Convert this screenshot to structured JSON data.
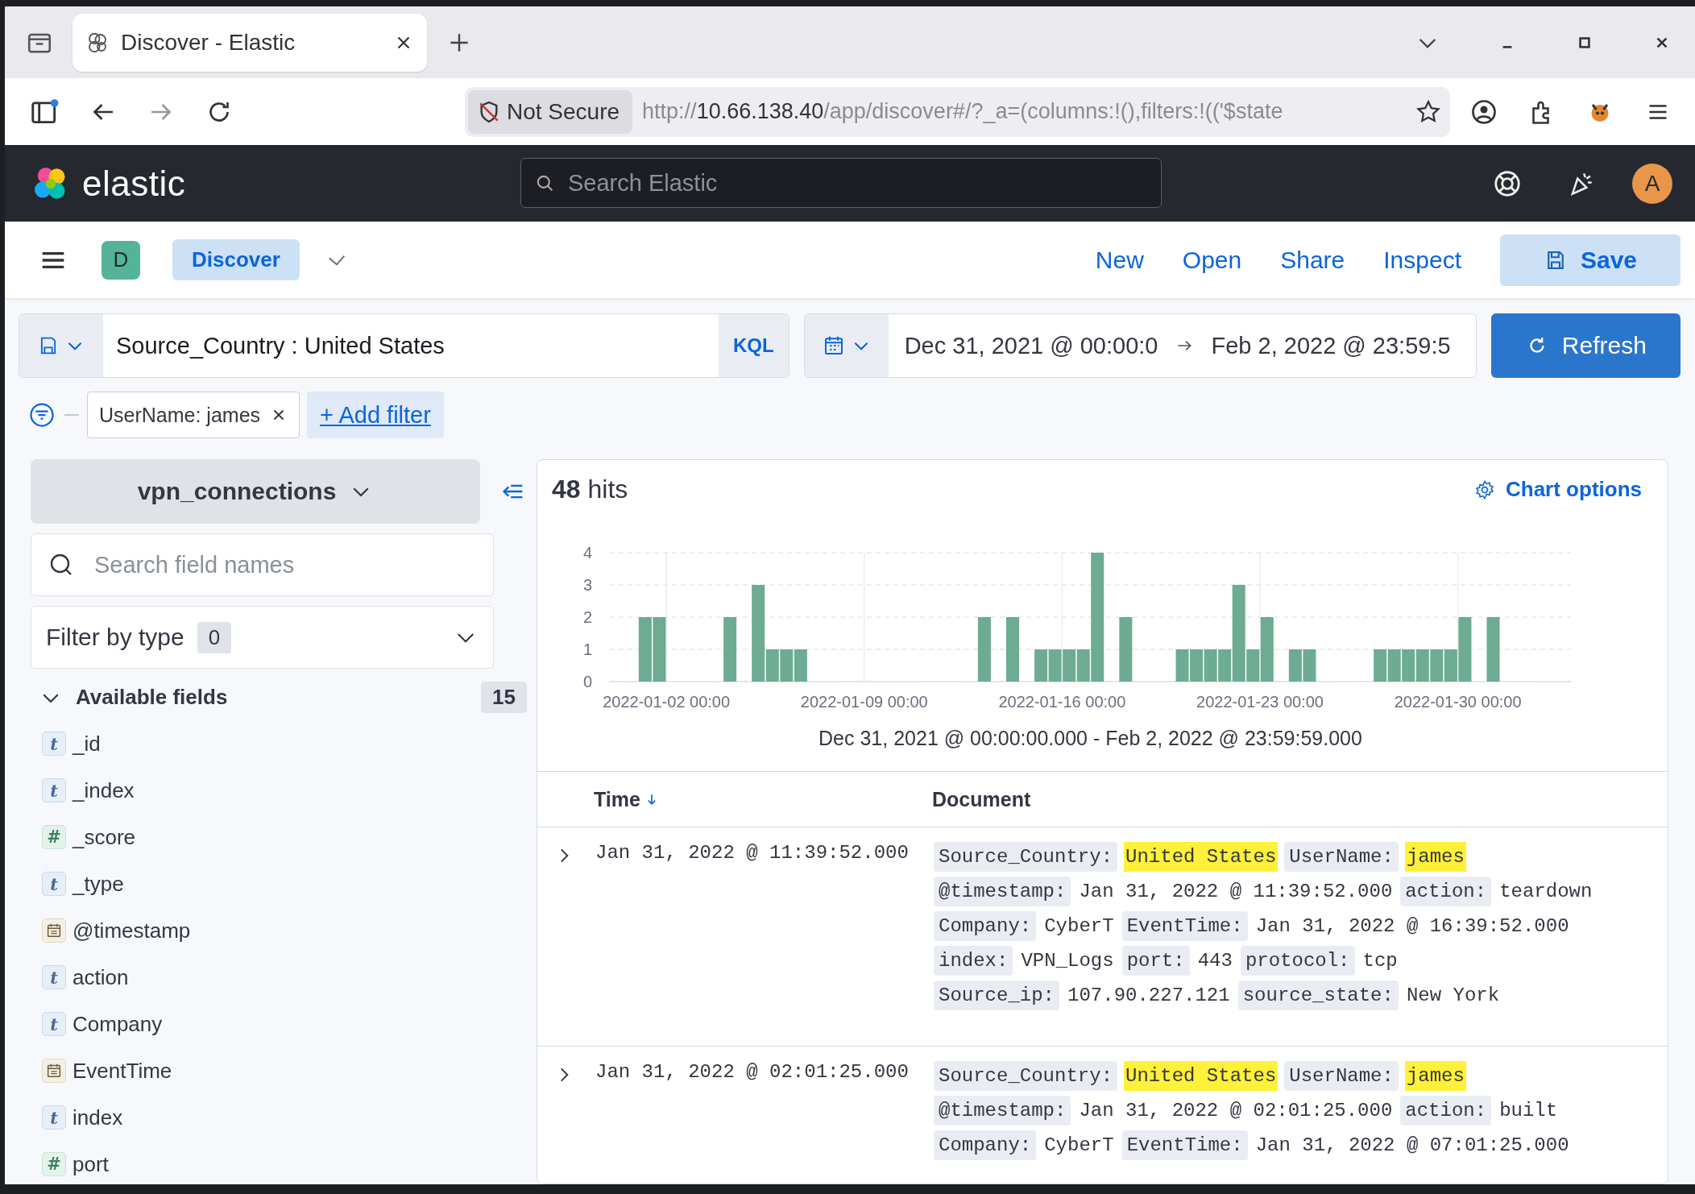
{
  "browser": {
    "tab_title": "Discover - Elastic",
    "security": "Not Secure",
    "url": {
      "scheme": "http://",
      "host": "10.66.138.40",
      "path": "/app/discover#/?_a=(columns:!(),filters:!(('$state"
    }
  },
  "header": {
    "logo_text": "elastic",
    "search_placeholder": "Search Elastic",
    "avatar": "A"
  },
  "app_bar": {
    "space": "D",
    "breadcrumb": "Discover",
    "actions": [
      "New",
      "Open",
      "Share",
      "Inspect"
    ],
    "save": "Save"
  },
  "query": {
    "text": "Source_Country : United States",
    "language": "KQL",
    "start": "Dec 31, 2021 @ 00:00:0",
    "end": "Feb 2, 2022 @ 23:59:5",
    "refresh": "Refresh"
  },
  "filters": [
    {
      "label": "UserName: james"
    }
  ],
  "add_filter": "+ Add filter",
  "sidebar": {
    "index_pattern": "vpn_connections",
    "search_placeholder": "Search field names",
    "filter_label": "Filter by type",
    "filter_count": "0",
    "section": {
      "title": "Available fields",
      "count": "15",
      "expanded": true
    },
    "fields": [
      {
        "name": "_id",
        "kind": "string",
        "token": "t"
      },
      {
        "name": "_index",
        "kind": "string",
        "token": "t"
      },
      {
        "name": "_score",
        "kind": "number",
        "token": "#"
      },
      {
        "name": "_type",
        "kind": "string",
        "token": "t"
      },
      {
        "name": "@timestamp",
        "kind": "date"
      },
      {
        "name": "action",
        "kind": "string",
        "token": "t"
      },
      {
        "name": "Company",
        "kind": "string",
        "token": "t"
      },
      {
        "name": "EventTime",
        "kind": "date"
      },
      {
        "name": "index",
        "kind": "string",
        "token": "t"
      },
      {
        "name": "port",
        "kind": "number",
        "token": "#"
      }
    ]
  },
  "results": {
    "hits": "48",
    "hits_label": "hits",
    "chart_options": "Chart options",
    "range_label": "Dec 31, 2021 @ 00:00:00.000 - Feb 2, 2022 @ 23:59:59.000",
    "chart_data": {
      "type": "bar",
      "categories": [
        null,
        null,
        null,
        null,
        "2022-01-02 00:00",
        null,
        null,
        null,
        null,
        null,
        null,
        null,
        null,
        null,
        null,
        null,
        null,
        null,
        "2022-01-09 00:00",
        null,
        null,
        null,
        null,
        null,
        null,
        null,
        null,
        null,
        null,
        null,
        null,
        null,
        "2022-01-16 00:00",
        null,
        null,
        null,
        null,
        null,
        null,
        null,
        null,
        null,
        null,
        null,
        null,
        null,
        "2022-01-23 00:00",
        null,
        null,
        null,
        null,
        null,
        null,
        null,
        null,
        null,
        null,
        null,
        null,
        null,
        "2022-01-30 00:00",
        null,
        null,
        null,
        null,
        null,
        null,
        null
      ],
      "series": [
        {
          "color": "#6dab93",
          "values": [
            0,
            0,
            2,
            2,
            0,
            0,
            0,
            0,
            2,
            0,
            3,
            1,
            1,
            1,
            0,
            0,
            0,
            0,
            0,
            0,
            0,
            0,
            0,
            0,
            0,
            0,
            2,
            0,
            2,
            0,
            1,
            1,
            1,
            1,
            4,
            0,
            2,
            0,
            0,
            0,
            1,
            1,
            1,
            1,
            3,
            1,
            2,
            0,
            1,
            1,
            0,
            0,
            0,
            0,
            1,
            1,
            1,
            1,
            1,
            1,
            2,
            0,
            2,
            0,
            0,
            0,
            0,
            0
          ]
        }
      ],
      "ylim": [
        0,
        4
      ],
      "yticks": [
        0,
        1,
        2,
        3,
        4
      ],
      "grid": true
    },
    "columns": [
      "Time",
      "Document"
    ],
    "rows": [
      {
        "time": "Jan 31, 2022 @ 11:39:52.000",
        "fields": [
          {
            "key": "Source_Country:",
            "value": "United States",
            "highlight": true
          },
          {
            "key": "UserName:",
            "value": "james",
            "highlight": true
          },
          {
            "key": "@timestamp:",
            "value": "Jan 31, 2022 @ 11:39:52.000",
            "highlight": false
          },
          {
            "key": "action:",
            "value": "teardown",
            "highlight": false
          },
          {
            "key": "Company:",
            "value": "CyberT",
            "highlight": false
          },
          {
            "key": "EventTime:",
            "value": "Jan 31, 2022 @ 16:39:52.000",
            "highlight": false
          },
          {
            "key": "index:",
            "value": "VPN_Logs",
            "highlight": false
          },
          {
            "key": "port:",
            "value": "443",
            "highlight": false
          },
          {
            "key": "protocol:",
            "value": "tcp",
            "highlight": false
          },
          {
            "key": "Source_ip:",
            "value": "107.90.227.121",
            "highlight": false
          },
          {
            "key": "source_state:",
            "value": "New York",
            "highlight": false
          }
        ]
      },
      {
        "time": "Jan 31, 2022 @ 02:01:25.000",
        "fields": [
          {
            "key": "Source_Country:",
            "value": "United States",
            "highlight": true
          },
          {
            "key": "UserName:",
            "value": "james",
            "highlight": true
          },
          {
            "key": "@timestamp:",
            "value": "Jan 31, 2022 @ 02:01:25.000",
            "highlight": false
          },
          {
            "key": "action:",
            "value": "built",
            "highlight": false
          },
          {
            "key": "Company:",
            "value": "CyberT",
            "highlight": false
          },
          {
            "key": "EventTime:",
            "value": "Jan 31, 2022 @ 07:01:25.000",
            "highlight": false
          }
        ]
      }
    ]
  }
}
